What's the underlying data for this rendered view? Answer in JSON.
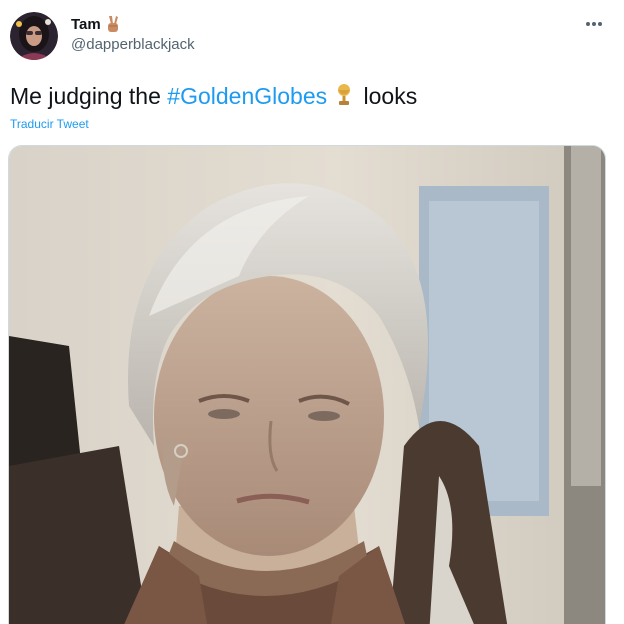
{
  "author": {
    "display_name": "Tam",
    "handle": "@dapperblackjack",
    "name_emoji": "victory-hand-emoji",
    "avatar": "profile-photo"
  },
  "more_icon": "more-options-icon",
  "tweet": {
    "text_before": "Me judging the ",
    "hashtag": "#GoldenGlobes",
    "emoji": "trophy-emoji",
    "text_after": " looks",
    "translate_label": "Traducir Tweet"
  },
  "media": {
    "type": "gif-still",
    "subject": "woman-with-silver-hair"
  },
  "colors": {
    "link": "#1d9bf0",
    "text": "#0f1419",
    "secondary": "#536471",
    "border": "#cfd9de"
  }
}
